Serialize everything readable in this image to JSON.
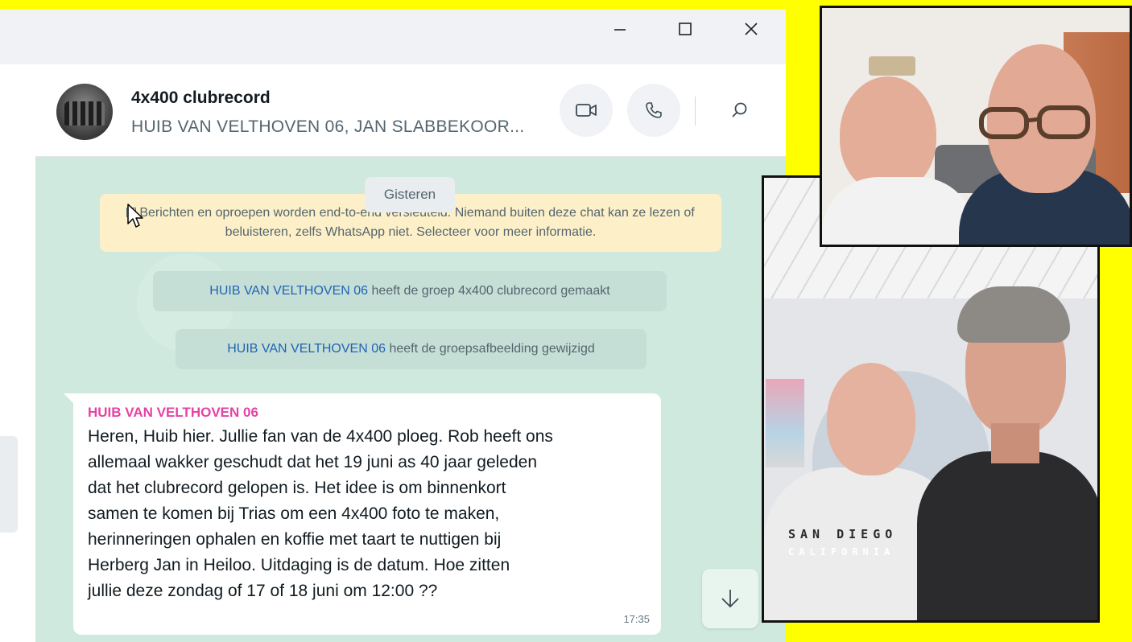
{
  "window": {
    "controls": {
      "minimize": "minimize-icon",
      "maximize": "maximize-icon",
      "close": "close-icon"
    }
  },
  "chat": {
    "title": "4x400 clubrecord",
    "subtitle": "HUIB VAN VELTHOVEN 06, JAN SLABBEKOOR...",
    "header_icons": [
      "video-call-icon",
      "voice-call-icon",
      "search-icon"
    ]
  },
  "messages": {
    "date_chip": "Gisteren",
    "encryption_notice": "Berichten en oproepen worden end-to-end versleuteld. Niemand buiten deze chat kan ze lezen of beluisteren, zelfs WhatsApp niet. Selecteer voor meer informatie.",
    "system": [
      {
        "actor": "HUIB VAN VELTHOVEN 06",
        "text": "heeft de groep 4x400 clubrecord  gemaakt"
      },
      {
        "actor": "HUIB VAN VELTHOVEN 06",
        "text": "heeft de groepsafbeelding gewijzigd"
      }
    ],
    "message": {
      "sender": "HUIB VAN VELTHOVEN 06",
      "text": "Heren, Huib hier. Jullie fan van de 4x400 ploeg. Rob heeft ons\nallemaal wakker geschudt dat het 19 juni as 40 jaar geleden\ndat het clubrecord gelopen is. Het idee is om binnenkort\nsamen te komen bij Trias om een 4x400 foto te maken,\nherinneringen ophalen en koffie met taart te nuttigen bij\nHerberg Jan in Heiloo. Uitdaging is de datum. Hoe zitten\njullie deze zondag of 17 of 18 juni om 12:00 ??",
      "time": "17:35",
      "sender_color": "#e542a3"
    }
  },
  "photos": {
    "shirt_text_line1": "SAN DIEGO",
    "shirt_text_line2": "CALIFORNIA"
  },
  "colors": {
    "page_background": "#ffff00",
    "chat_background": "#cfe9de",
    "actor_link": "#1f63b5",
    "encryption_banner": "#fdf0c8"
  }
}
